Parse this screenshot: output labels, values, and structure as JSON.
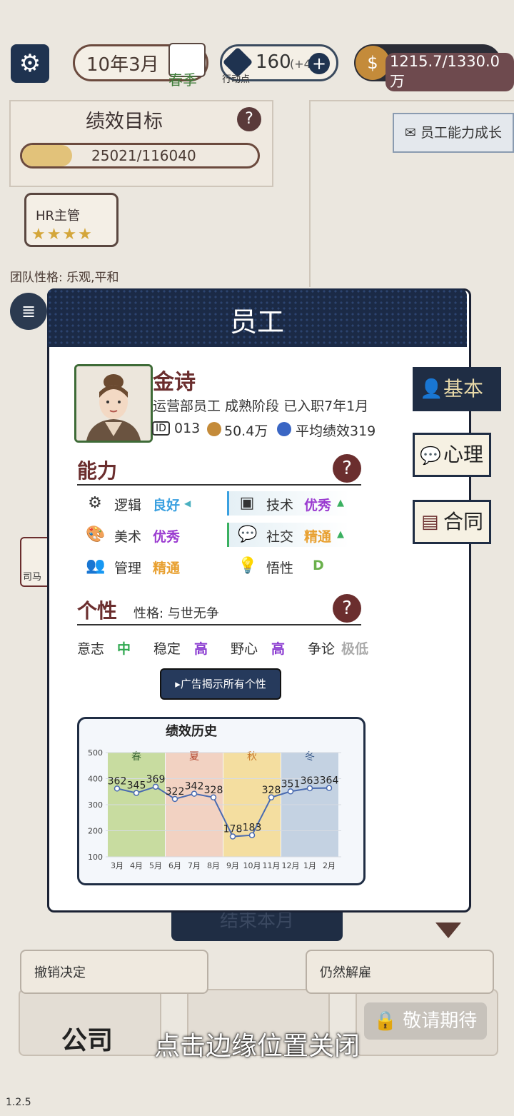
{
  "topbar": {
    "date": "10年3月",
    "season": "春季",
    "action_points": "160",
    "action_points_extra": "(+4",
    "action_points_label": "行动点",
    "money": "1215.7/1330.0万"
  },
  "goal": {
    "title": "绩效目标",
    "progress": "25021/116040"
  },
  "growth_button": "员工能力成长",
  "hr": {
    "title": "HR主管",
    "stars": "★★★★"
  },
  "team_trait": "团队性格: 乐观,平和",
  "background_text": {
    "person_tag": "司马"
  },
  "modal": {
    "title": "员工",
    "name": "金诗",
    "subinfo": "运营部员工 成熟阶段 已入职7年1月",
    "id_tag": "ID",
    "id": "013",
    "salary": "50.4万",
    "avg_performance": "平均绩效319"
  },
  "ability": {
    "title": "能力",
    "items": [
      {
        "label": "逻辑",
        "value": "良好",
        "trend": "◀",
        "color": "#3aa0e0"
      },
      {
        "label": "技术",
        "value": "优秀",
        "trend": "▲",
        "color": "#9a3ad0"
      },
      {
        "label": "美术",
        "value": "优秀",
        "trend": "",
        "color": "#9a3ad0"
      },
      {
        "label": "社交",
        "value": "精通",
        "trend": "▲",
        "color": "#e8a030"
      },
      {
        "label": "管理",
        "value": "精通",
        "trend": "",
        "color": "#e8a030"
      },
      {
        "label": "悟性",
        "value": "D",
        "trend": "",
        "color": "#6ab04c"
      }
    ]
  },
  "personality": {
    "title": "个性",
    "character": "性格: 与世无争",
    "traits": [
      {
        "label": "意志",
        "value": "中",
        "color": "#2fa84f"
      },
      {
        "label": "稳定",
        "value": "高",
        "color": "#8a3ad0"
      },
      {
        "label": "野心",
        "value": "高",
        "color": "#8a3ad0"
      },
      {
        "label": "争论",
        "value": "极低",
        "color": "#aaaaaa"
      }
    ],
    "ad_button": "▸广告揭示所有个性"
  },
  "chart_data": {
    "type": "line",
    "title": "绩效历史",
    "categories": [
      "3月",
      "4月",
      "5月",
      "6月",
      "7月",
      "8月",
      "9月",
      "10月",
      "11月",
      "12月",
      "1月",
      "2月"
    ],
    "series": [
      {
        "values": [
          362,
          345,
          369,
          322,
          342,
          328,
          178,
          183,
          328,
          351,
          363,
          364
        ]
      }
    ],
    "ylim": [
      100,
      500
    ],
    "yticks": [
      100,
      200,
      300,
      400,
      500
    ],
    "seasons": [
      {
        "label": "春",
        "color": "#c8dca0",
        "text_color": "#3e6b37",
        "start": 0
      },
      {
        "label": "夏",
        "color": "#f2d2c2",
        "text_color": "#b2452e",
        "start": 3
      },
      {
        "label": "秋",
        "color": "#f4dea0",
        "text_color": "#c97a2a",
        "start": 6
      },
      {
        "label": "冬",
        "color": "#c4d2e2",
        "text_color": "#3a5a8a",
        "start": 9
      }
    ]
  },
  "side_tabs": [
    {
      "label": "基本",
      "active": true
    },
    {
      "label": "心理",
      "active": false
    },
    {
      "label": "合同",
      "active": false
    }
  ],
  "bottom": {
    "end_month": "结束本月",
    "revoke": "撤销决定",
    "fire": "仍然解雇",
    "company": "公司",
    "coming_soon": "🔒 敬请期待",
    "close_hint": "点击边缘位置关闭",
    "version": "1.2.5"
  }
}
